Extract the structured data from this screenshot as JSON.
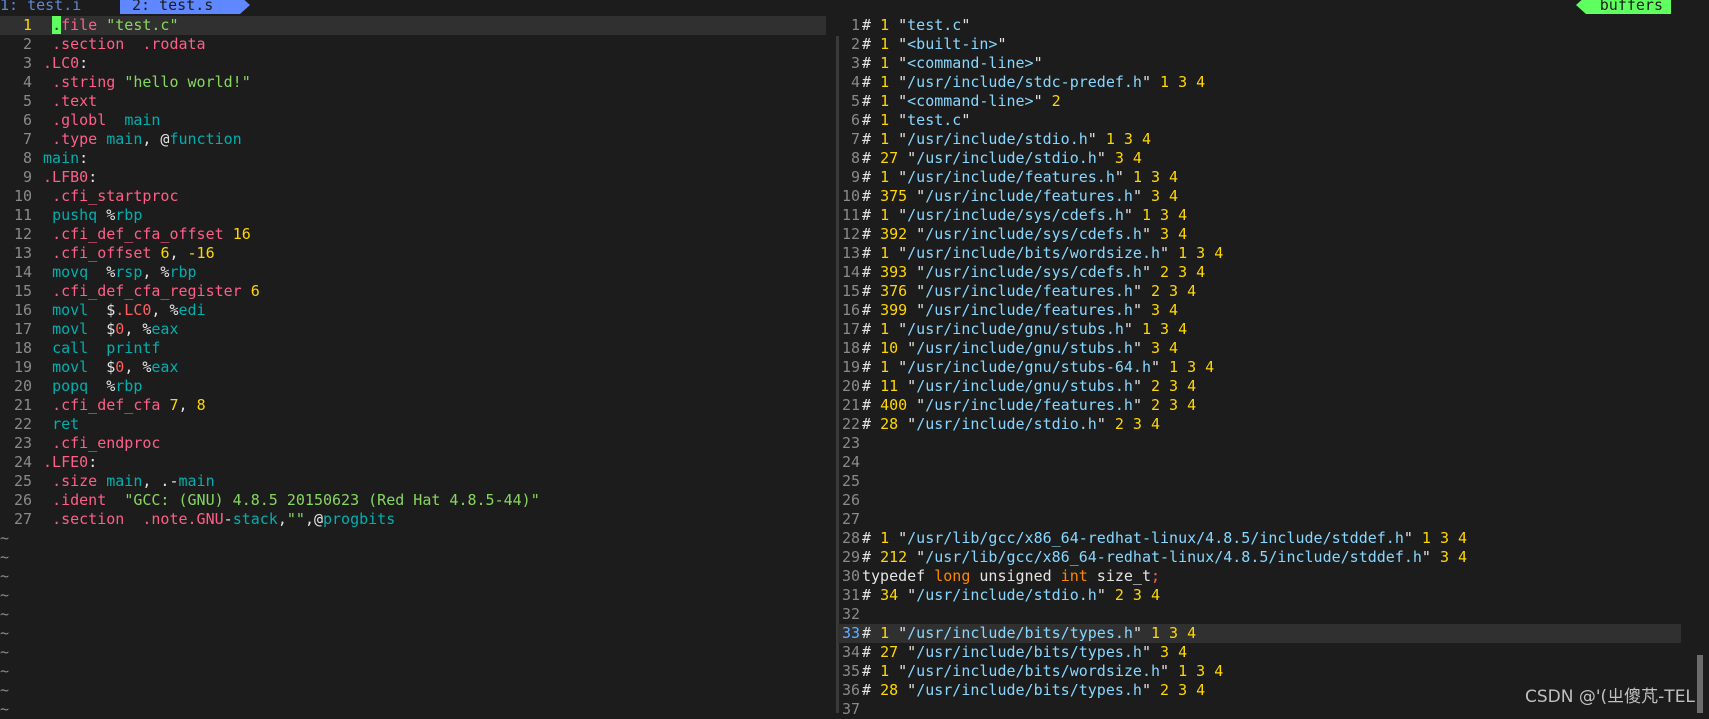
{
  "tabs": [
    {
      "label": "1: test.i"
    },
    {
      "label": "2: test.s"
    }
  ],
  "buffers_label": "buffers",
  "left_pane": {
    "lines": [
      {
        "num": "1",
        "text": " .file \"test.c\""
      },
      {
        "num": "2",
        "text": " .section  .rodata"
      },
      {
        "num": "3",
        "text": ".LC0:"
      },
      {
        "num": "4",
        "text": " .string \"hello world!\""
      },
      {
        "num": "5",
        "text": " .text"
      },
      {
        "num": "6",
        "text": " .globl  main"
      },
      {
        "num": "7",
        "text": " .type main, @function"
      },
      {
        "num": "8",
        "text": "main:"
      },
      {
        "num": "9",
        "text": ".LFB0:"
      },
      {
        "num": "10",
        "text": " .cfi_startproc"
      },
      {
        "num": "11",
        "text": " pushq %rbp"
      },
      {
        "num": "12",
        "text": " .cfi_def_cfa_offset 16"
      },
      {
        "num": "13",
        "text": " .cfi_offset 6, -16"
      },
      {
        "num": "14",
        "text": " movq  %rsp, %rbp"
      },
      {
        "num": "15",
        "text": " .cfi_def_cfa_register 6"
      },
      {
        "num": "16",
        "text": " movl  $.LC0, %edi"
      },
      {
        "num": "17",
        "text": " movl  $0, %eax"
      },
      {
        "num": "18",
        "text": " call  printf"
      },
      {
        "num": "19",
        "text": " movl  $0, %eax"
      },
      {
        "num": "20",
        "text": " popq  %rbp"
      },
      {
        "num": "21",
        "text": " .cfi_def_cfa 7, 8"
      },
      {
        "num": "22",
        "text": " ret"
      },
      {
        "num": "23",
        "text": " .cfi_endproc"
      },
      {
        "num": "24",
        "text": ".LFE0:"
      },
      {
        "num": "25",
        "text": " .size main, .-main"
      },
      {
        "num": "26",
        "text": " .ident  \"GCC: (GNU) 4.8.5 20150623 (Red Hat 4.8.5-44)\""
      },
      {
        "num": "27",
        "text": " .section  .note.GNU-stack,\"\",@progbits"
      }
    ],
    "tilde_count": 10,
    "tilde_char": "~"
  },
  "right_pane": {
    "lines": [
      {
        "num": "1",
        "text": "# 1 \"test.c\""
      },
      {
        "num": "2",
        "text": "# 1 \"<built-in>\""
      },
      {
        "num": "3",
        "text": "# 1 \"<command-line>\""
      },
      {
        "num": "4",
        "text": "# 1 \"/usr/include/stdc-predef.h\" 1 3 4"
      },
      {
        "num": "5",
        "text": "# 1 \"<command-line>\" 2"
      },
      {
        "num": "6",
        "text": "# 1 \"test.c\""
      },
      {
        "num": "7",
        "text": "# 1 \"/usr/include/stdio.h\" 1 3 4"
      },
      {
        "num": "8",
        "text": "# 27 \"/usr/include/stdio.h\" 3 4"
      },
      {
        "num": "9",
        "text": "# 1 \"/usr/include/features.h\" 1 3 4"
      },
      {
        "num": "10",
        "text": "# 375 \"/usr/include/features.h\" 3 4"
      },
      {
        "num": "11",
        "text": "# 1 \"/usr/include/sys/cdefs.h\" 1 3 4"
      },
      {
        "num": "12",
        "text": "# 392 \"/usr/include/sys/cdefs.h\" 3 4"
      },
      {
        "num": "13",
        "text": "# 1 \"/usr/include/bits/wordsize.h\" 1 3 4"
      },
      {
        "num": "14",
        "text": "# 393 \"/usr/include/sys/cdefs.h\" 2 3 4"
      },
      {
        "num": "15",
        "text": "# 376 \"/usr/include/features.h\" 2 3 4"
      },
      {
        "num": "16",
        "text": "# 399 \"/usr/include/features.h\" 3 4"
      },
      {
        "num": "17",
        "text": "# 1 \"/usr/include/gnu/stubs.h\" 1 3 4"
      },
      {
        "num": "18",
        "text": "# 10 \"/usr/include/gnu/stubs.h\" 3 4"
      },
      {
        "num": "19",
        "text": "# 1 \"/usr/include/gnu/stubs-64.h\" 1 3 4"
      },
      {
        "num": "20",
        "text": "# 11 \"/usr/include/gnu/stubs.h\" 2 3 4"
      },
      {
        "num": "21",
        "text": "# 400 \"/usr/include/features.h\" 2 3 4"
      },
      {
        "num": "22",
        "text": "# 28 \"/usr/include/stdio.h\" 2 3 4"
      },
      {
        "num": "23",
        "text": ""
      },
      {
        "num": "24",
        "text": ""
      },
      {
        "num": "25",
        "text": ""
      },
      {
        "num": "26",
        "text": ""
      },
      {
        "num": "27",
        "text": ""
      },
      {
        "num": "28",
        "text": "# 1 \"/usr/lib/gcc/x86_64-redhat-linux/4.8.5/include/stddef.h\" 1 3 4"
      },
      {
        "num": "29",
        "text": "# 212 \"/usr/lib/gcc/x86_64-redhat-linux/4.8.5/include/stddef.h\" 3 4"
      },
      {
        "num": "30",
        "text": "typedef long unsigned int size_t;"
      },
      {
        "num": "31",
        "text": "# 34 \"/usr/include/stdio.h\" 2 3 4"
      },
      {
        "num": "32",
        "text": ""
      },
      {
        "num": "33",
        "text": "# 1 \"/usr/include/bits/types.h\" 1 3 4"
      },
      {
        "num": "34",
        "text": "# 27 \"/usr/include/bits/types.h\" 3 4"
      },
      {
        "num": "35",
        "text": "# 1 \"/usr/include/bits/wordsize.h\" 1 3 4"
      },
      {
        "num": "36",
        "text": "# 28 \"/usr/include/bits/types.h\" 2 3 4"
      },
      {
        "num": "37",
        "text": ""
      }
    ]
  },
  "watermark": "CSDN @'(ㄓ傻芃-TEL"
}
